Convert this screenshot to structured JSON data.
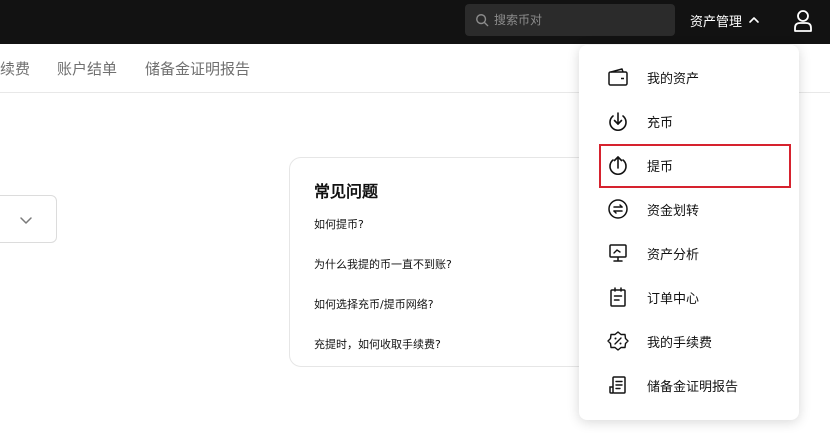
{
  "header": {
    "search_placeholder": "搜索币对",
    "asset_management": "资产管理"
  },
  "subnav": {
    "tabs": [
      "续费",
      "账户结单",
      "储备金证明报告"
    ]
  },
  "faq": {
    "title": "常见问题",
    "questions": [
      "如何提币?",
      "为什么我提的币一直不到账?",
      "如何选择充币/提币网络?",
      "充提时，如何收取手续费?"
    ]
  },
  "dropdown": {
    "items": [
      {
        "label": "我的资产",
        "icon": "wallet-icon"
      },
      {
        "label": "充币",
        "icon": "deposit-icon"
      },
      {
        "label": "提币",
        "icon": "withdraw-icon"
      },
      {
        "label": "资金划转",
        "icon": "transfer-icon"
      },
      {
        "label": "资产分析",
        "icon": "analysis-icon"
      },
      {
        "label": "订单中心",
        "icon": "order-icon"
      },
      {
        "label": "我的手续费",
        "icon": "fee-icon"
      },
      {
        "label": "储备金证明报告",
        "icon": "report-icon"
      }
    ],
    "highlighted": "提币"
  },
  "colors": {
    "topbar": "#121212",
    "highlight_border": "#d6222e"
  }
}
